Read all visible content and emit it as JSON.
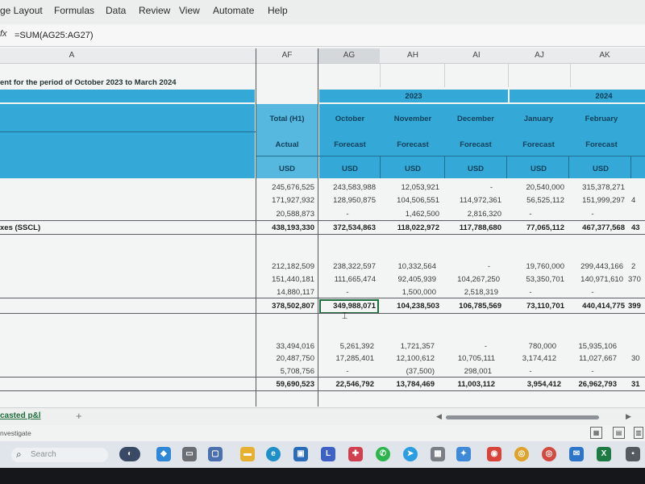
{
  "menu": [
    "ge Layout",
    "Formulas",
    "Data",
    "Review",
    "View",
    "Automate",
    "Help"
  ],
  "formula_bar": {
    "fx": "fx",
    "formula": "=SUM(AG25:AG27)"
  },
  "columns": [
    "A",
    "AF",
    "AG",
    "AH",
    "AI",
    "AJ",
    "AK"
  ],
  "sheet": {
    "title": "ent for the period of October 2023 to March 2024",
    "years": [
      "2023",
      "2024"
    ],
    "months": [
      "Total (H1)",
      "October",
      "November",
      "December",
      "January",
      "February"
    ],
    "types": [
      "Actual",
      "Forecast",
      "Forecast",
      "Forecast",
      "Forecast",
      "Forecast"
    ],
    "currency": [
      "USD",
      "USD",
      "USD",
      "USD",
      "USD",
      "USD"
    ],
    "row_label_sscl": "xes (SSCL)",
    "section1": {
      "rows": [
        [
          "245,676,525",
          "243,583,988",
          "12,053,921",
          "-",
          "20,540,000",
          "315,378,271"
        ],
        [
          "171,927,932",
          "128,950,875",
          "104,506,551",
          "114,972,361",
          "56,525,112",
          "151,999,297"
        ],
        [
          "20,588,873",
          "-",
          "1,462,500",
          "2,816,320",
          "-",
          "-"
        ]
      ],
      "total": [
        "438,193,330",
        "372,534,863",
        "118,022,972",
        "117,788,680",
        "77,065,112",
        "467,377,568"
      ]
    },
    "section2": {
      "rows": [
        [
          "212,182,509",
          "238,322,597",
          "10,332,564",
          "-",
          "19,760,000",
          "299,443,166"
        ],
        [
          "151,440,181",
          "111,665,474",
          "92,405,939",
          "104,267,250",
          "53,350,701",
          "140,971,610"
        ],
        [
          "14,880,117",
          "-",
          "1,500,000",
          "2,518,319",
          "-",
          "-"
        ]
      ],
      "total": [
        "378,502,807",
        "349,988,071",
        "104,238,503",
        "106,785,569",
        "73,110,701",
        "440,414,775"
      ]
    },
    "section3": {
      "rows": [
        [
          "33,494,016",
          "5,261,392",
          "1,721,357",
          "-",
          "780,000",
          "15,935,106"
        ],
        [
          "20,487,750",
          "17,285,401",
          "12,100,612",
          "10,705,111",
          "3,174,412",
          "11,027,667"
        ],
        [
          "5,708,756",
          "-",
          "(37,500)",
          "298,001",
          "-",
          "-"
        ]
      ],
      "total": [
        "59,690,523",
        "22,546,792",
        "13,784,469",
        "11,003,112",
        "3,954,412",
        "26,962,793"
      ]
    },
    "overflow": [
      "4",
      "43",
      "2",
      "370",
      "399",
      "30",
      "31"
    ]
  },
  "sheet_tab": "casted p&l",
  "add_sheet": "+",
  "status_text": "nvestigate",
  "taskbar": {
    "search_placeholder": "Search"
  }
}
